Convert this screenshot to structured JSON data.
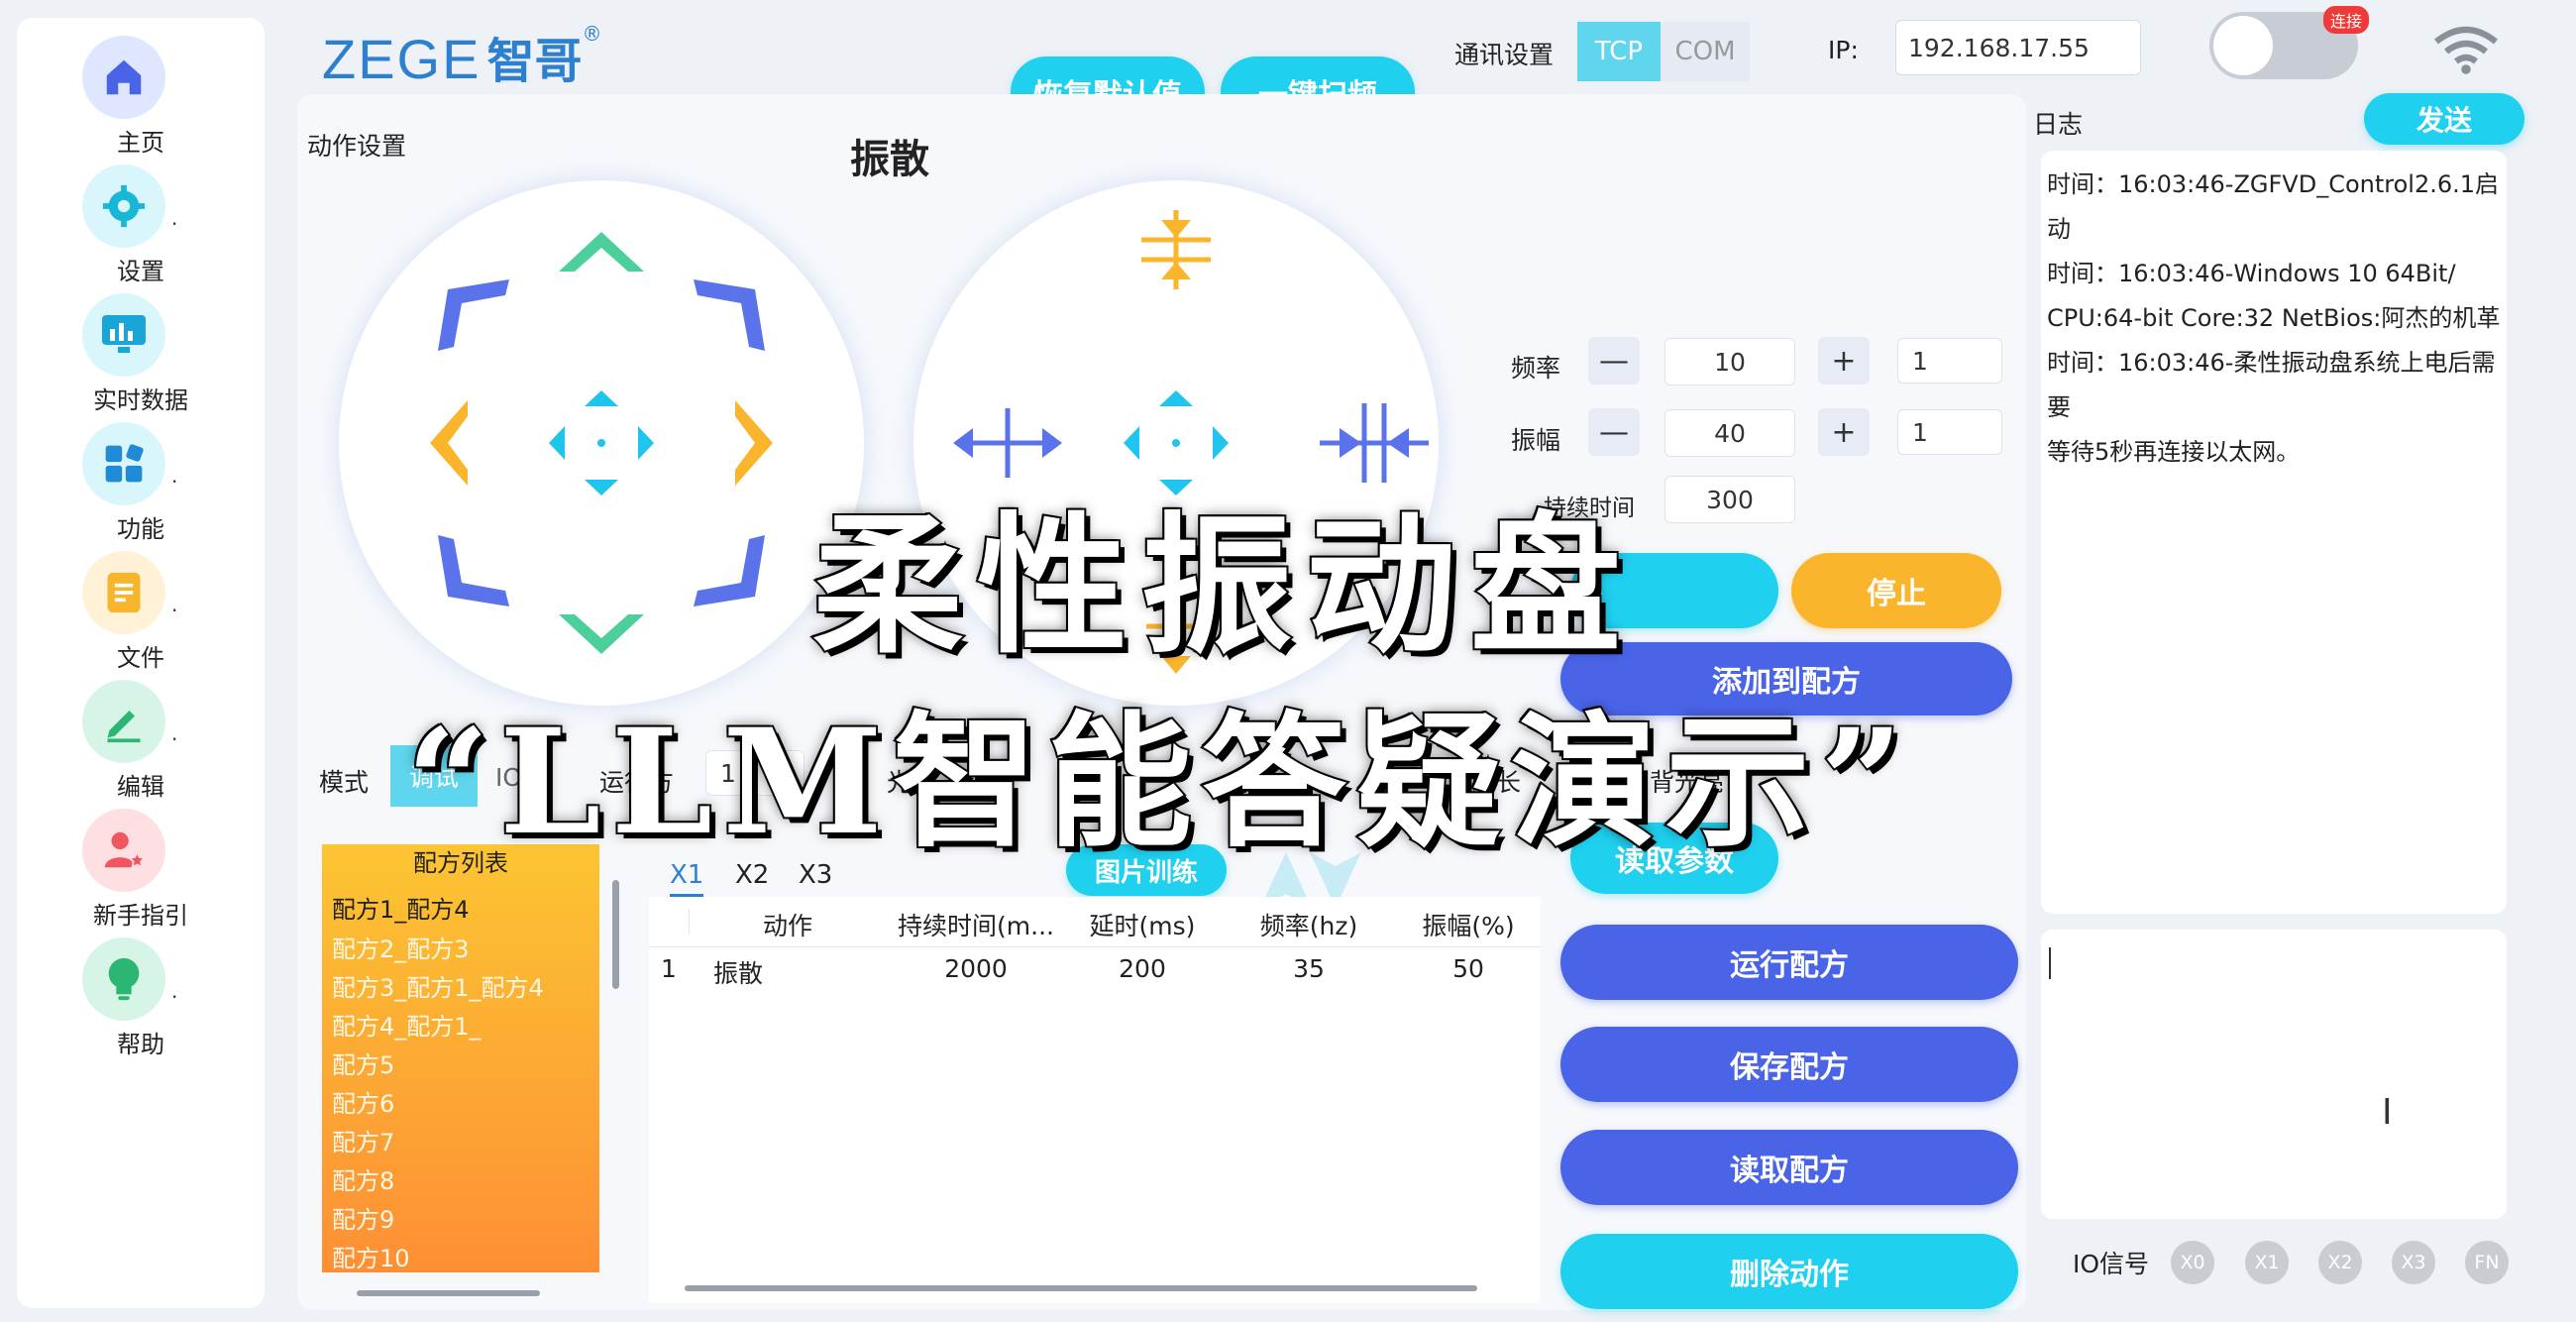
{
  "sidebar": {
    "items": [
      {
        "label": "主页",
        "icon": "home-icon",
        "bg": "#dfe6ff",
        "color": "#4a64e8",
        "has_more": false
      },
      {
        "label": "设置",
        "icon": "gear-icon",
        "bg": "#d8f6fb",
        "color": "#19b7d6",
        "has_more": true
      },
      {
        "label": "实时数据",
        "icon": "chart-icon",
        "bg": "#d8f6fb",
        "color": "#19a6d6",
        "has_more": false
      },
      {
        "label": "功能",
        "icon": "grid-icon",
        "bg": "#d8f6fb",
        "color": "#1f8bd8",
        "has_more": true
      },
      {
        "label": "文件",
        "icon": "file-icon",
        "bg": "#fff2d6",
        "color": "#f7b52c",
        "has_more": true
      },
      {
        "label": "编辑",
        "icon": "pencil-icon",
        "bg": "#d7f5e6",
        "color": "#2bb673",
        "has_more": true
      },
      {
        "label": "新手指引",
        "icon": "user-star-icon",
        "bg": "#ffe0e2",
        "color": "#f05560",
        "has_more": false
      },
      {
        "label": "帮助",
        "icon": "bulb-icon",
        "bg": "#d7f5e6",
        "color": "#2bb673",
        "has_more": true
      }
    ]
  },
  "brand": {
    "latin": "ZEGE",
    "cn": "智哥",
    "mark": "®"
  },
  "header": {
    "restore_label": "恢复默认值",
    "scan_label": "一键扫频",
    "comm_label": "通讯设置",
    "tcp_label": "TCP",
    "com_label": "COM",
    "ip_label": "IP:",
    "ip_value": "192.168.17.55",
    "connect_badge": "连接"
  },
  "action": {
    "section_label": "动作设置",
    "current_action": "振散"
  },
  "controls": {
    "freq_label": "频率",
    "freq_value": "10",
    "freq_step": "1",
    "amp_label": "振幅",
    "amp_value": "40",
    "amp_step": "1",
    "duration_label": "持续时间",
    "duration_value": "300",
    "minus": "—",
    "plus": "+",
    "stop_label": "停止",
    "add_label": "添加到配方",
    "read_params_label": "读取参数"
  },
  "mode": {
    "label": "模式",
    "debug_label": "调试",
    "io_label": "IO",
    "run_label": "运行方",
    "run_value": "1",
    "light_label": "光亮",
    "duration_label": "时长",
    "backlight_label": "背光亮"
  },
  "recipes": {
    "title": "配方列表",
    "items": [
      "配方1_配方4",
      "配方2_配方3",
      "配方3_配方1_配方4",
      "配方4_配方1_",
      "配方5",
      "配方6",
      "配方7",
      "配方8",
      "配方9",
      "配方10"
    ]
  },
  "tabs": [
    "X1",
    "X2",
    "X3"
  ],
  "image_train_label": "图片训练",
  "table": {
    "headers": [
      "动作",
      "持续时间(m...",
      "延时(ms)",
      "频率(hz)",
      "振幅(%)"
    ],
    "rows": [
      [
        "1",
        "振散",
        "2000",
        "200",
        "35",
        "50"
      ]
    ]
  },
  "recipe_actions": {
    "run": "运行配方",
    "save": "保存配方",
    "read": "读取配方",
    "delete": "删除动作"
  },
  "log": {
    "label": "日志",
    "send_label": "发送",
    "lines": [
      "时间：16:03:46-ZGFVD_Control2.6.1启动",
      "时间：16:03:46-Windows 10 64Bit/",
      "CPU:64-bit Core:32 NetBios:阿杰的机革",
      "时间：16:03:46-柔性振动盘系统上电后需要",
      "等待5秒再连接以太网。"
    ]
  },
  "io": {
    "label": "IO信号",
    "signals": [
      "X0",
      "X1",
      "X2",
      "X3",
      "FN"
    ]
  },
  "overlay": {
    "line1": "柔性振动盘",
    "line2": "“LLM智能答疑演示”"
  },
  "colors": {
    "cyan": "#1fd0ef",
    "blue": "#4a64e8",
    "orange": "#fbb52c",
    "green": "#4ccf9a"
  }
}
